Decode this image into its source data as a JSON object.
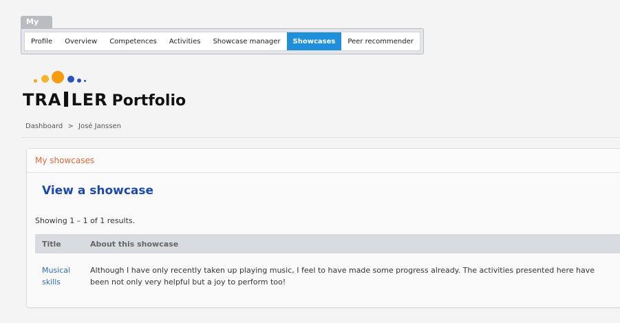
{
  "nav": {
    "my_label": "My",
    "items": [
      {
        "label": "Profile"
      },
      {
        "label": "Overview"
      },
      {
        "label": "Competences"
      },
      {
        "label": "Activities"
      },
      {
        "label": "Showcase manager"
      },
      {
        "label": "Showcases",
        "active": true
      },
      {
        "label": "Peer recommender"
      }
    ],
    "active_color": "#1e8fd8"
  },
  "logo": {
    "brand_a": "TRA",
    "brand_b": "LER",
    "suffix": "Portfolio",
    "dot_colors": [
      "#f5a623",
      "#f39c12",
      "#2a52be",
      "#2a52be"
    ]
  },
  "breadcrumb": {
    "home": "Dashboard",
    "separator": ">",
    "current": "José Janssen"
  },
  "panel": {
    "header": "My showcases",
    "heading": "View a showcase",
    "results": "Showing 1 – 1 of 1 results.",
    "columns": [
      "Title",
      "About this showcase"
    ],
    "rows": [
      {
        "title": "Musical skills",
        "about": "Although I have only recently taken up playing music, I feel to have made some progress already. The activities presented here have been not only very helpful but a joy to perform too!"
      }
    ]
  }
}
